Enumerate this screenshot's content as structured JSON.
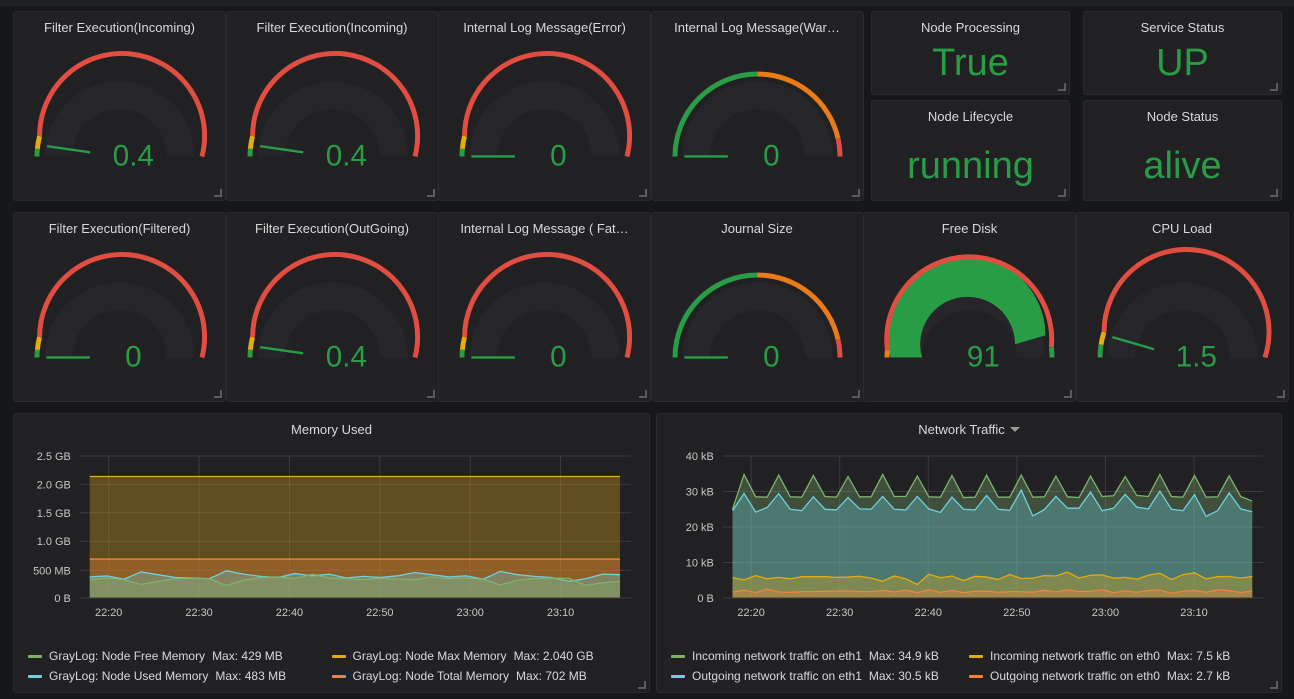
{
  "theme": {
    "page_bg": "#161719",
    "panel_bg": "#212124",
    "panel_border": "#2b2b2f",
    "title_color": "#d8d9da",
    "value_green": "#299c46",
    "threshold_green": "#299c46",
    "threshold_orange": "#e5ac0e",
    "threshold_red": "#e24d42",
    "grid_color": "#3a3a40"
  },
  "gauges": [
    {
      "title": "Filter Execution(Incoming)",
      "value": "0.4",
      "fraction": 0.045,
      "fill": false,
      "thresholds": [
        {
          "from": 0.0,
          "to": 0.03,
          "color": "#299c46"
        },
        {
          "from": 0.03,
          "to": 0.08,
          "color": "#e5ac0e"
        },
        {
          "from": 0.08,
          "to": 1.0,
          "color": "#e24d42"
        }
      ]
    },
    {
      "title": "Filter Execution(Incoming)",
      "value": "0.4",
      "fraction": 0.045,
      "fill": false,
      "thresholds": [
        {
          "from": 0.0,
          "to": 0.03,
          "color": "#299c46"
        },
        {
          "from": 0.03,
          "to": 0.08,
          "color": "#e5ac0e"
        },
        {
          "from": 0.08,
          "to": 1.0,
          "color": "#e24d42"
        }
      ]
    },
    {
      "title": "Internal Log Message(Error)",
      "value": "0",
      "fraction": 0.0,
      "fill": false,
      "thresholds": [
        {
          "from": 0.0,
          "to": 0.03,
          "color": "#299c46"
        },
        {
          "from": 0.03,
          "to": 0.08,
          "color": "#e5ac0e"
        },
        {
          "from": 0.08,
          "to": 1.0,
          "color": "#e24d42"
        }
      ]
    },
    {
      "title": "Internal Log Message(War…",
      "value": "0",
      "fraction": 0.0,
      "fill": false,
      "thresholds": [
        {
          "from": 0.0,
          "to": 0.5,
          "color": "#299c46"
        },
        {
          "from": 0.5,
          "to": 0.93,
          "color": "#eb7b18"
        },
        {
          "from": 0.93,
          "to": 1.0,
          "color": "#e24d42"
        }
      ]
    },
    {
      "title": "Filter Execution(Filtered)",
      "value": "0",
      "fraction": 0.0,
      "fill": false,
      "thresholds": [
        {
          "from": 0.0,
          "to": 0.03,
          "color": "#299c46"
        },
        {
          "from": 0.03,
          "to": 0.08,
          "color": "#e5ac0e"
        },
        {
          "from": 0.08,
          "to": 1.0,
          "color": "#e24d42"
        }
      ]
    },
    {
      "title": "Filter Execution(OutGoing)",
      "value": "0.4",
      "fraction": 0.045,
      "fill": false,
      "thresholds": [
        {
          "from": 0.0,
          "to": 0.03,
          "color": "#299c46"
        },
        {
          "from": 0.03,
          "to": 0.08,
          "color": "#e5ac0e"
        },
        {
          "from": 0.08,
          "to": 1.0,
          "color": "#e24d42"
        }
      ]
    },
    {
      "title": "Internal Log Message ( Fat…",
      "value": "0",
      "fraction": 0.0,
      "fill": false,
      "thresholds": [
        {
          "from": 0.0,
          "to": 0.03,
          "color": "#299c46"
        },
        {
          "from": 0.03,
          "to": 0.08,
          "color": "#e5ac0e"
        },
        {
          "from": 0.08,
          "to": 1.0,
          "color": "#e24d42"
        }
      ]
    },
    {
      "title": "Journal Size",
      "value": "0",
      "fraction": 0.0,
      "fill": false,
      "thresholds": [
        {
          "from": 0.0,
          "to": 0.5,
          "color": "#299c46"
        },
        {
          "from": 0.5,
          "to": 0.93,
          "color": "#eb7b18"
        },
        {
          "from": 0.93,
          "to": 1.0,
          "color": "#e24d42"
        }
      ]
    },
    {
      "title": "Free Disk",
      "value": "91",
      "fraction": 0.91,
      "fill": true,
      "fill_color": "#299c46",
      "thresholds": [
        {
          "from": 0.0,
          "to": 0.03,
          "color": "#eb7b18"
        },
        {
          "from": 0.03,
          "to": 0.96,
          "color": "#e24d42"
        },
        {
          "from": 0.96,
          "to": 1.0,
          "color": "#299c46"
        }
      ]
    },
    {
      "title": "CPU Load",
      "value": "1.5",
      "fraction": 0.09,
      "fill": false,
      "thresholds": [
        {
          "from": 0.0,
          "to": 0.05,
          "color": "#299c46"
        },
        {
          "from": 0.05,
          "to": 0.1,
          "color": "#e5ac0e"
        },
        {
          "from": 0.1,
          "to": 1.0,
          "color": "#e24d42"
        }
      ]
    }
  ],
  "stats": [
    {
      "title": "Node Processing",
      "value": "True"
    },
    {
      "title": "Service Status",
      "value": "UP"
    },
    {
      "title": "Node Lifecycle",
      "value": "running"
    },
    {
      "title": "Node Status",
      "value": "alive"
    }
  ],
  "graphs": [
    {
      "title": "Memory Used",
      "has_caret": false,
      "chart_data": {
        "type": "area",
        "title": "Memory Used",
        "xlabel": "",
        "ylabel": "",
        "grid": true,
        "legend_position": "bottom",
        "ylim": [
          0,
          2684354560
        ],
        "ytick_labels": [
          "2.5 GB",
          "2.0 GB",
          "1.5 GB",
          "1.0 GB",
          "500 MB",
          "0 B"
        ],
        "ytick_values": [
          2684354560,
          2147483648,
          1610612736,
          1073741824,
          524288000,
          0
        ],
        "xtick_labels": [
          "22:20",
          "22:30",
          "22:40",
          "22:50",
          "23:00",
          "23:10"
        ],
        "series": [
          {
            "name": "GrayLog: Node Max Memory",
            "stat_label": "Max",
            "stat_value": "2.040 GB",
            "color": "#e5ac0e",
            "values": [
              2190,
              2190,
              2190,
              2190,
              2190,
              2190,
              2190,
              2190,
              2190,
              2190,
              2190,
              2190,
              2190,
              2190,
              2190,
              2190,
              2190,
              2190,
              2190,
              2190,
              2190,
              2190,
              2190,
              2190,
              2190,
              2190,
              2190,
              2190,
              2190,
              2190,
              2190,
              2190
            ]
          },
          {
            "name": "GrayLog: Node Total Memory",
            "stat_label": "Max",
            "stat_value": "702 MB",
            "color": "#ef843c",
            "values": [
              702,
              702,
              702,
              702,
              702,
              702,
              702,
              702,
              702,
              702,
              702,
              702,
              702,
              702,
              702,
              702,
              702,
              702,
              702,
              702,
              702,
              702,
              702,
              702,
              702,
              702,
              702,
              702,
              702,
              702,
              702,
              702
            ]
          },
          {
            "name": "GrayLog: Node Used Memory",
            "stat_label": "Max",
            "stat_value": "483 MB",
            "color": "#7eb26d_cyan",
            "values": [
              380,
              398,
              340,
              470,
              420,
              370,
              360,
              350,
              490,
              430,
              390,
              370,
              440,
              400,
              430,
              360,
              390,
              370,
              400,
              460,
              420,
              380,
              400,
              340,
              480,
              420,
              390,
              370,
              300,
              350,
              430,
              420
            ]
          },
          {
            "name": "GrayLog: Node Free Memory",
            "stat_label": "Max",
            "stat_value": "429 MB",
            "color": "#9ac48a",
            "values": [
              330,
              360,
              330,
              245,
              300,
              350,
              355,
              350,
              225,
              320,
              370,
              380,
              350,
              430,
              360,
              350,
              330,
              355,
              340,
              330,
              380,
              350,
              360,
              340,
              235,
              320,
              350,
              360,
              355,
              230,
              275,
              300
            ]
          }
        ]
      },
      "legend": [
        {
          "label": "GrayLog: Node Free Memory",
          "stat": "Max: 429 MB",
          "color": "#7eb26d"
        },
        {
          "label": "GrayLog: Node Max Memory",
          "stat": "Max: 2.040 GB",
          "color": "#e5ac0e"
        },
        {
          "label": "GrayLog: Node Used Memory",
          "stat": "Max: 483 MB",
          "color": "#6ed0e0"
        },
        {
          "label": "GrayLog: Node Total Memory",
          "stat": "Max: 702 MB",
          "color": "#ef843c"
        }
      ]
    },
    {
      "title": "Network Traffic",
      "has_caret": true,
      "chart_data": {
        "type": "area",
        "title": "Network Traffic",
        "xlabel": "",
        "ylabel": "",
        "grid": true,
        "legend_position": "bottom",
        "ylim": [
          0,
          40000
        ],
        "ytick_labels": [
          "40 kB",
          "30 kB",
          "20 kB",
          "10 kB",
          "0 B"
        ],
        "ytick_values": [
          40000,
          30000,
          20000,
          10000,
          0
        ],
        "xtick_labels": [
          "22:20",
          "22:30",
          "22:40",
          "22:50",
          "23:00",
          "23:10"
        ],
        "series": [
          {
            "name": "Incoming network traffic on eth1",
            "stat_label": "Max",
            "stat_value": "34.9 kB",
            "color": "#7eb26d",
            "values": [
              25.0,
              34.8,
              28.5,
              28.4,
              34.6,
              28.5,
              28.4,
              34.5,
              28.6,
              28.4,
              34.2,
              28.5,
              28.5,
              34.8,
              28.6,
              28.6,
              34.3,
              28.5,
              28.4,
              34.5,
              28.3,
              28.4,
              34.6,
              28.4,
              28.4,
              34.6,
              28.4,
              28.5,
              34.3,
              28.5,
              28.3,
              34.3,
              28.6,
              28.8,
              34.2,
              28.9,
              28.6,
              34.8,
              28.6,
              28.4,
              34.5,
              28.4,
              28.5,
              34.4,
              28.6,
              27.3
            ]
          },
          {
            "name": "Outgoing network traffic on eth1",
            "stat_label": "Max",
            "stat_value": "30.5 kB",
            "color": "#6ed0e0",
            "values": [
              24.6,
              29.5,
              24.2,
              25.5,
              29.4,
              25.0,
              24.6,
              28.5,
              25.0,
              24.8,
              28.3,
              25.1,
              25.0,
              28.6,
              25.0,
              24.8,
              28.6,
              25.1,
              24.1,
              28.4,
              25.0,
              24.8,
              28.9,
              25.0,
              24.7,
              30.4,
              23.1,
              24.9,
              28.6,
              25.3,
              25.3,
              29.8,
              24.6,
              25.3,
              29.2,
              25.6,
              25.1,
              30.1,
              25.0,
              24.6,
              29.1,
              23.0,
              24.6,
              29.6,
              25.1,
              24.3
            ]
          },
          {
            "name": "Incoming network traffic on eth0",
            "stat_label": "Max",
            "stat_value": "7.5 kB",
            "color": "#e5ac0e",
            "values": [
              5.7,
              5.1,
              6.3,
              5.4,
              5.8,
              5.4,
              6.0,
              6.0,
              6.0,
              5.8,
              5.9,
              6.1,
              5.6,
              4.7,
              6.2,
              5.4,
              3.8,
              6.7,
              5.7,
              6.2,
              4.9,
              6.1,
              5.9,
              5.2,
              6.6,
              5.5,
              5.6,
              6.3,
              6.2,
              7.3,
              5.6,
              6.4,
              6.5,
              5.6,
              5.8,
              5.3,
              6.4,
              7.0,
              5.2,
              6.6,
              7.1,
              5.4,
              6.0,
              6.1,
              5.6,
              6.1
            ]
          },
          {
            "name": "Outgoing network traffic on eth0",
            "stat_label": "Max",
            "stat_value": "2.7 kB",
            "color": "#ef843c",
            "values": [
              1.7,
              2.2,
              1.5,
              2.5,
              1.7,
              1.6,
              1.8,
              1.8,
              1.9,
              1.9,
              2.0,
              1.8,
              1.8,
              2.1,
              1.7,
              2.2,
              1.5,
              2.3,
              1.6,
              2.1,
              1.5,
              1.9,
              1.9,
              1.6,
              1.8,
              1.8,
              1.6,
              2.2,
              1.7,
              2.3,
              1.8,
              1.9,
              2.3,
              1.5,
              2.0,
              1.6,
              2.1,
              2.2,
              1.3,
              1.9,
              2.1,
              1.6,
              2.3,
              2.1,
              1.5,
              2.0
            ]
          }
        ]
      },
      "legend": [
        {
          "label": "Incoming network traffic on eth1",
          "stat": "Max: 34.9 kB",
          "color": "#7eb26d"
        },
        {
          "label": "Incoming network traffic on eth0",
          "stat": "Max: 7.5 kB",
          "color": "#e5ac0e"
        },
        {
          "label": "Outgoing network traffic on eth1",
          "stat": "Max: 30.5 kB",
          "color": "#6ed0e0"
        },
        {
          "label": "Outgoing network traffic on eth0",
          "stat": "Max: 2.7 kB",
          "color": "#ef843c"
        }
      ]
    }
  ]
}
